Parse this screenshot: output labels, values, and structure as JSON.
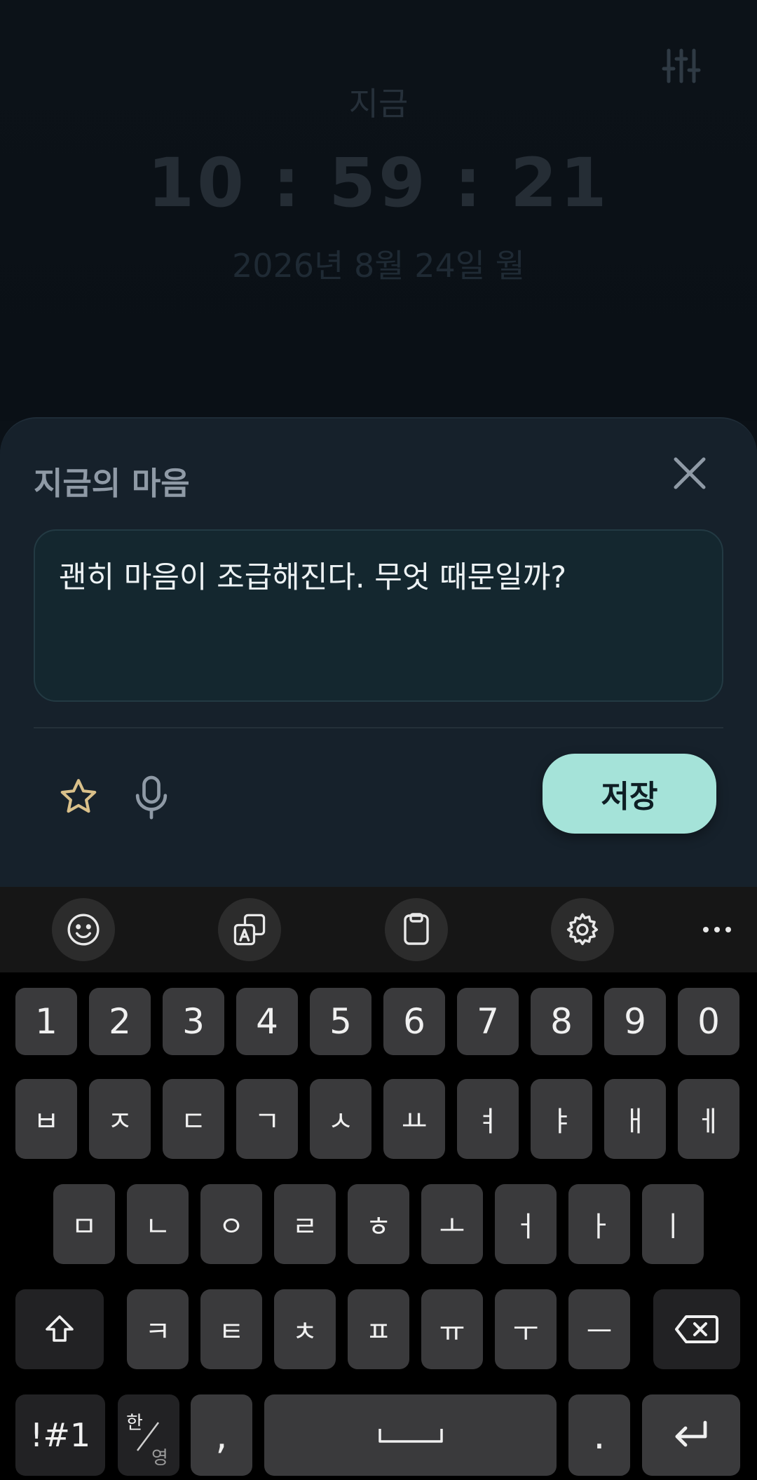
{
  "clock": {
    "label": "지금",
    "time": "10 : 59 : 21",
    "date": "2026년 8월 24일 월"
  },
  "sheet": {
    "title": "지금의 마음",
    "note_text": "괜히 마음이 조급해진다. 무엇 때문일까?",
    "save_label": "저장"
  },
  "keyboard": {
    "toolbar_icons": [
      "emoji-icon",
      "translate-icon",
      "clipboard-icon",
      "settings-icon",
      "more-icon"
    ],
    "number_row": [
      "1",
      "2",
      "3",
      "4",
      "5",
      "6",
      "7",
      "8",
      "9",
      "0"
    ],
    "row1": [
      "ㅂ",
      "ㅈ",
      "ㄷ",
      "ㄱ",
      "ㅅ",
      "ㅛ",
      "ㅕ",
      "ㅑ",
      "ㅐ",
      "ㅔ"
    ],
    "row2": [
      "ㅁ",
      "ㄴ",
      "ㅇ",
      "ㄹ",
      "ㅎ",
      "ㅗ",
      "ㅓ",
      "ㅏ",
      "ㅣ"
    ],
    "row3": [
      "ㅋ",
      "ㅌ",
      "ㅊ",
      "ㅍ",
      "ㅠ",
      "ㅜ",
      "ㅡ"
    ],
    "symbols_label": "!#1",
    "lang_top": "한",
    "lang_bottom": "영",
    "comma": ",",
    "period": "."
  },
  "colors": {
    "accent": "#a5e3d9",
    "sheet_bg": "#16212b",
    "key_bg": "#3a3a3c",
    "star": "#d9c08a"
  }
}
